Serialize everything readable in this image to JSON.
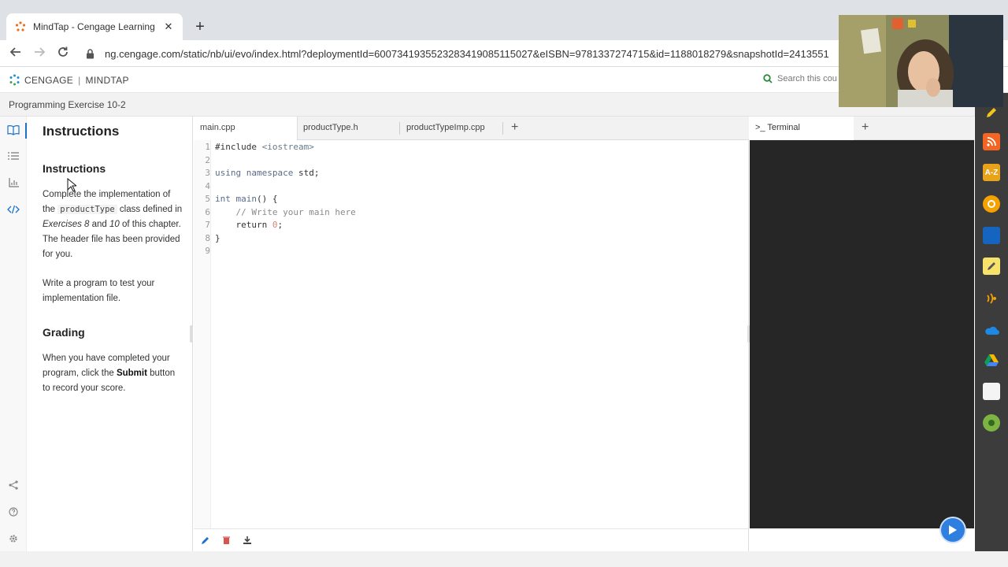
{
  "browser": {
    "tab_title": "MindTap - Cengage Learning",
    "tab_close": "✕",
    "new_tab": "+",
    "url": "ng.cengage.com/static/nb/ui/evo/index.html?deploymentId=6007341935523283419085115027&eISBN=9781337274715&id=1188018279&snapshotId=2413551"
  },
  "header": {
    "brand_left": "CENGAGE",
    "brand_sep": "|",
    "brand_right": "MINDTAP",
    "search_placeholder": "Search this cou"
  },
  "subheader": {
    "title": "Programming Exercise 10-2"
  },
  "instructions": {
    "panel_title": "Instructions",
    "section1_title": "Instructions",
    "p1_a": "Complete the implementation of the ",
    "p1_code": "productType",
    "p1_b": " class defined in ",
    "p1_em1": "Exercises 8",
    "p1_c": " and ",
    "p1_em2": "10",
    "p1_d": " of this chapter. The header file has been provided for you.",
    "p2": "Write a program to test your implementation file.",
    "section2_title": "Grading",
    "p3_a": "When you have completed your program, click the ",
    "p3_strong": "Submit",
    "p3_b": " button to record your score."
  },
  "editor": {
    "tabs": [
      "main.cpp",
      "productType.h",
      "productTypeImp.cpp"
    ],
    "add_tab": "+",
    "lines": [
      {
        "n": "1",
        "parts": [
          [
            "",
            "#include "
          ],
          [
            "str",
            "<iostream>"
          ]
        ]
      },
      {
        "n": "2",
        "parts": []
      },
      {
        "n": "3",
        "parts": [
          [
            "kw",
            "using"
          ],
          [
            "",
            " "
          ],
          [
            "kw",
            "namespace"
          ],
          [
            "",
            " std;"
          ]
        ]
      },
      {
        "n": "4",
        "parts": []
      },
      {
        "n": "5",
        "parts": [
          [
            "kw",
            "int"
          ],
          [
            "",
            " "
          ],
          [
            "kw",
            "main"
          ],
          [
            "",
            "() {"
          ]
        ]
      },
      {
        "n": "6",
        "parts": [
          [
            "cm",
            "    // Write your main here"
          ]
        ]
      },
      {
        "n": "7",
        "parts": [
          [
            "",
            "    return "
          ],
          [
            "num",
            "0"
          ],
          [
            "",
            ";"
          ]
        ]
      },
      {
        "n": "8",
        "parts": [
          [
            "",
            "}"
          ]
        ]
      },
      {
        "n": "9",
        "parts": []
      }
    ]
  },
  "terminal": {
    "tab_label": ">_  Terminal",
    "add_tab": "+"
  },
  "colors": {
    "accent": "#1a73c8",
    "terminal_bg": "#262626",
    "play_button": "#2f7fe0"
  }
}
